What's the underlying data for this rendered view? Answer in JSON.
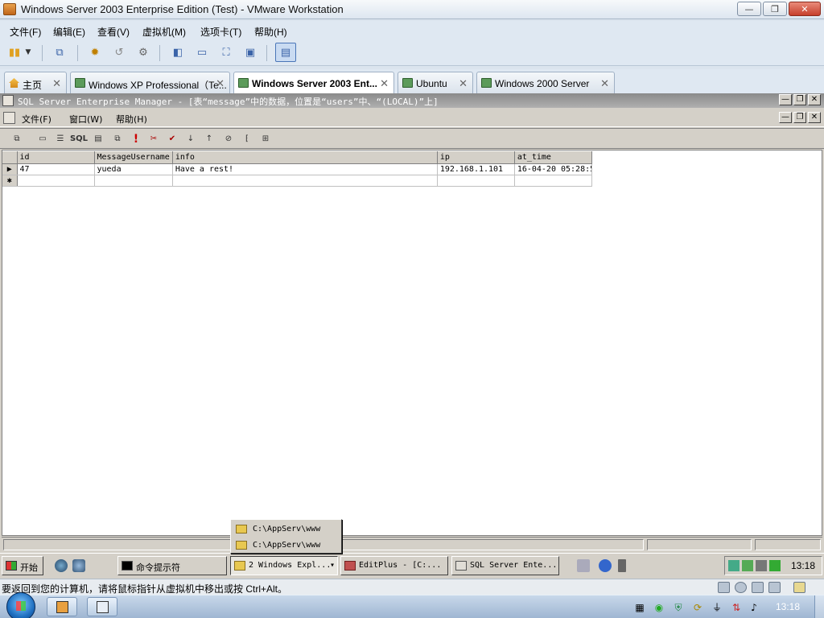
{
  "window": {
    "title": "Windows Server 2003 Enterprise Edition (Test) - VMware Workstation",
    "min_symbol": "—",
    "max_symbol": "❐",
    "close_symbol": "✕"
  },
  "menu": [
    "文件(F)",
    "编辑(E)",
    "查看(V)",
    "虚拟机(M)",
    "选项卡(T)",
    "帮助(H)"
  ],
  "tabs": [
    {
      "label": "主页",
      "icon": "home-icon"
    },
    {
      "label": "Windows XP Professional（Te...",
      "icon": "vm-icon"
    },
    {
      "label": "Windows Server 2003 Ent...",
      "icon": "vm-icon",
      "active": true
    },
    {
      "label": "Ubuntu",
      "icon": "vm-icon"
    },
    {
      "label": "Windows 2000 Server",
      "icon": "vm-icon"
    }
  ],
  "tab_close": "✕",
  "guest": {
    "mdi_title": "SQL Server Enterprise Manager - [表“message”中的数据，位置是“users”中、“(LOCAL)”上]",
    "menu": [
      "文件(F)",
      "窗口(W)",
      "帮助(H)"
    ],
    "toolbar": {
      "sql_label": "SQL",
      "exclamation": "!"
    },
    "grid": {
      "columns": [
        "id",
        "MessageUsername",
        "info",
        "ip",
        "at_time"
      ],
      "rows": [
        [
          "47",
          "yueda",
          "Have a rest!",
          "192.168.1.101",
          "16-04-20 05:28:5"
        ]
      ],
      "current_row_marker": "▶",
      "new_row_marker": "✱"
    },
    "popup_items": [
      "C:\\AppServ\\www",
      "C:\\AppServ\\www"
    ],
    "taskbar": {
      "start": "开始",
      "buttons": [
        "命令提示符",
        "2 Windows Expl...",
        "EditPlus - [C:...",
        "SQL Server Ente..."
      ],
      "dropdown_arrow": "▾",
      "clock": "13:18"
    }
  },
  "status_message": "要返回到您的计算机，请将鼠标指针从虚拟机中移出或按 Ctrl+Alt。",
  "host_taskbar": {
    "clock": "13:18"
  }
}
